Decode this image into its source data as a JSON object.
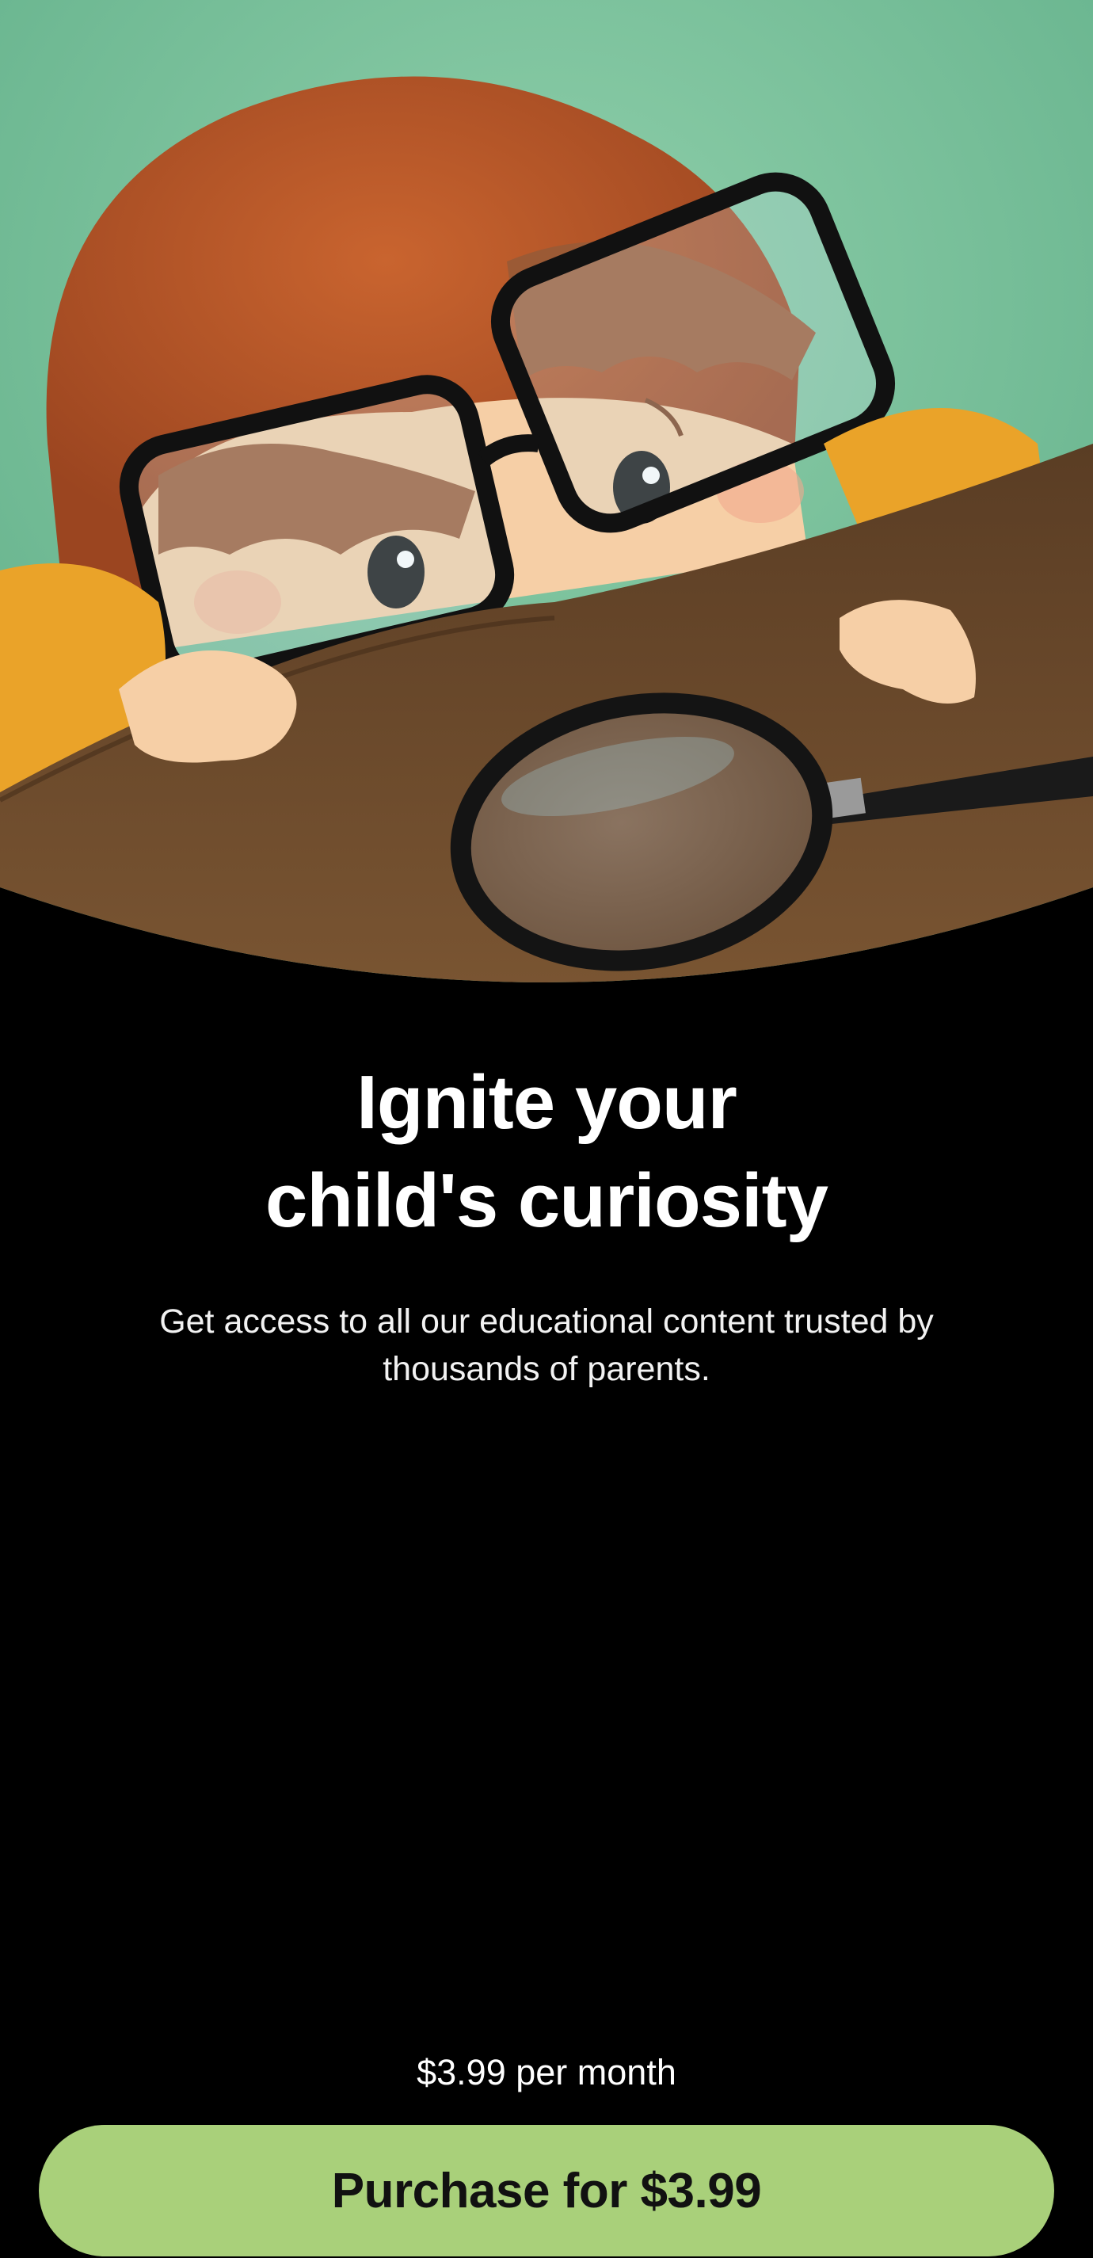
{
  "hero": {
    "image_subject": "illustration-child-peeking-over-table-with-magnifying-glass",
    "colors": {
      "background": "#6fb792",
      "hair": "#b1552a",
      "skin": "#f6cfa6",
      "sleeve": "#eaa329",
      "table": "#6b4a2b",
      "glasses": "#111111",
      "page_background": "#000000"
    }
  },
  "headline": {
    "line1": "Ignite your",
    "line2": "child's curiosity"
  },
  "subtitle": {
    "line1": "Get access to all our educational content trusted by",
    "line2": "thousands of parents."
  },
  "pricing": {
    "price_label": "$3.99 per month"
  },
  "purchase_button": {
    "label": "Purchase for $3.99",
    "color": "#a9d07a"
  }
}
